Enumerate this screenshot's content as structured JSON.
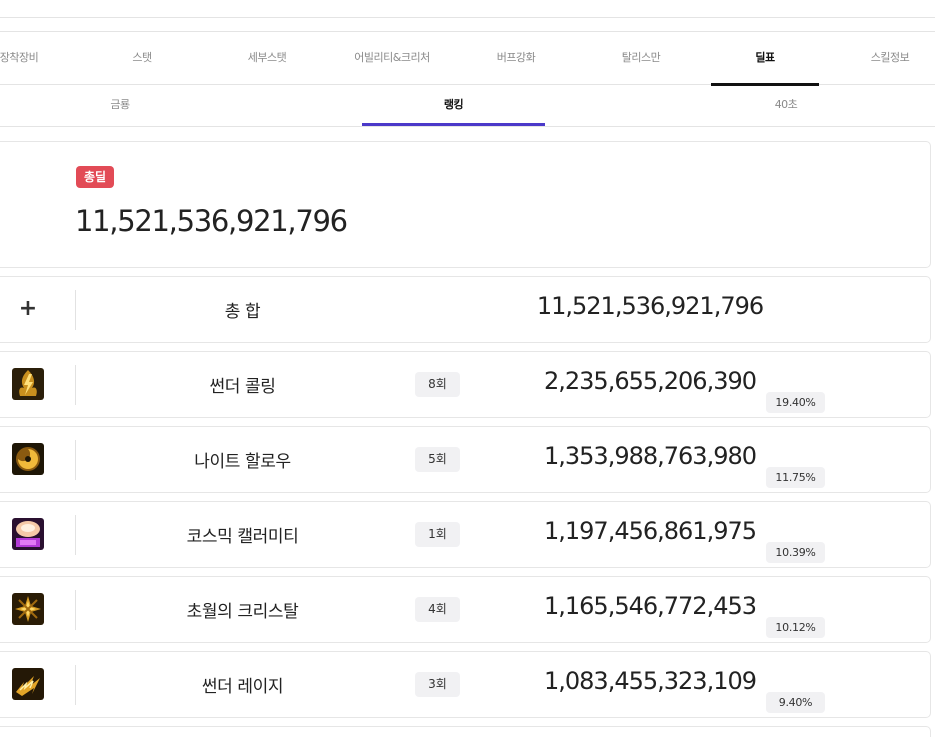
{
  "main_tabs": [
    {
      "label": "장착장비",
      "active": false
    },
    {
      "label": "스탯",
      "active": false
    },
    {
      "label": "세부스탯",
      "active": false
    },
    {
      "label": "어빌리티&크리처",
      "active": false
    },
    {
      "label": "버프강화",
      "active": false
    },
    {
      "label": "탈리스만",
      "active": false
    },
    {
      "label": "딜표",
      "active": true
    },
    {
      "label": "스킬정보",
      "active": false
    }
  ],
  "sub_tabs": [
    {
      "label": "금룡",
      "active": false
    },
    {
      "label": "랭킹",
      "active": true
    },
    {
      "label": "40초",
      "active": false
    }
  ],
  "summary": {
    "badge": "총딜",
    "value": "11,521,536,921,796",
    "badge_color": "#e24b56"
  },
  "total_row": {
    "icon": "plus-icon",
    "plus_glyph": "+",
    "name": "총 합",
    "damage": "11,521,536,921,796"
  },
  "skills": [
    {
      "name": "썬더 콜링",
      "count": "8회",
      "damage": "2,235,655,206,390",
      "percent": "19.40%",
      "icon": "thunder-calling-icon"
    },
    {
      "name": "나이트 할로우",
      "count": "5회",
      "damage": "1,353,988,763,980",
      "percent": "11.75%",
      "icon": "night-hollow-icon"
    },
    {
      "name": "코스믹 캘러미티",
      "count": "1회",
      "damage": "1,197,456,861,975",
      "percent": "10.39%",
      "icon": "cosmic-calamity-icon"
    },
    {
      "name": "초월의 크리스탈",
      "count": "4회",
      "damage": "1,165,546,772,453",
      "percent": "10.12%",
      "icon": "transcendent-crystal-icon"
    },
    {
      "name": "썬더 레이지",
      "count": "3회",
      "damage": "1,083,455,323,109",
      "percent": "9.40%",
      "icon": "thunder-rage-icon"
    }
  ],
  "colors": {
    "active_main_underline": "#111111",
    "active_sub_underline": "#4b39c9"
  }
}
